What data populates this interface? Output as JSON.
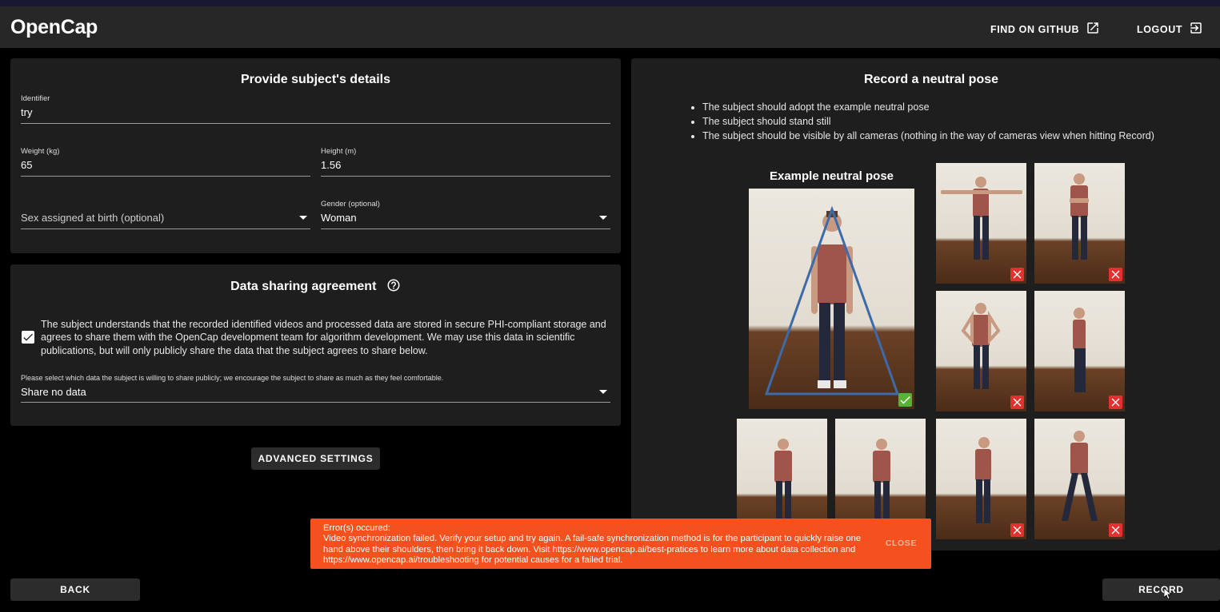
{
  "app": {
    "name": "OpenCap",
    "github_label": "FIND ON GITHUB",
    "logout_label": "LOGOUT"
  },
  "subject": {
    "title": "Provide subject's details",
    "identifier": {
      "label": "Identifier",
      "value": "try"
    },
    "weight": {
      "label": "Weight (kg)",
      "value": "65"
    },
    "height": {
      "label": "Height (m)",
      "value": "1.56"
    },
    "sex": {
      "placeholder": "Sex assigned at birth (optional)"
    },
    "gender": {
      "label": "Gender (optional)",
      "value": "Woman"
    }
  },
  "sharing": {
    "title": "Data sharing agreement",
    "agreement_text": "The subject understands that the recorded identified videos and processed data are stored in secure PHI-compliant storage and agrees to share them with the OpenCap development team for algorithm development. We may use this data in scientific publications, but will only publicly share the data that the subject agrees to share below.",
    "agreement_checked": true,
    "select_label": "Please select which data the subject is willing to share publicly; we encourage the subject to share as much as they feel comfortable.",
    "select_value": "Share no data"
  },
  "advanced_label": "ADVANCED SETTINGS",
  "neutral": {
    "title": "Record a neutral pose",
    "instructions": [
      "The subject should adopt the example neutral pose",
      "The subject should stand still",
      "The subject should be visible by all cameras (nothing in the way of cameras view when hitting Record)"
    ],
    "example_title": "Example neutral pose"
  },
  "error": {
    "heading": "Error(s) occured:",
    "message": "Video synchronization failed. Verify your setup and try again. A fail-safe synchronization method is for the participant to quickly raise one hand above their shoulders, then bring it back down. Visit https://www.opencap.ai/best-pratices to learn more about data collection and https://www.opencap.ai/troubleshooting for potential causes for a failed trial.",
    "close_label": "CLOSE"
  },
  "footer": {
    "back_label": "BACK",
    "record_label": "RECORD"
  },
  "colors": {
    "error_bg": "#f4511e",
    "ok_mark": "#57b337",
    "bad_mark": "#e53030",
    "panel_bg": "#1e1e1e"
  }
}
